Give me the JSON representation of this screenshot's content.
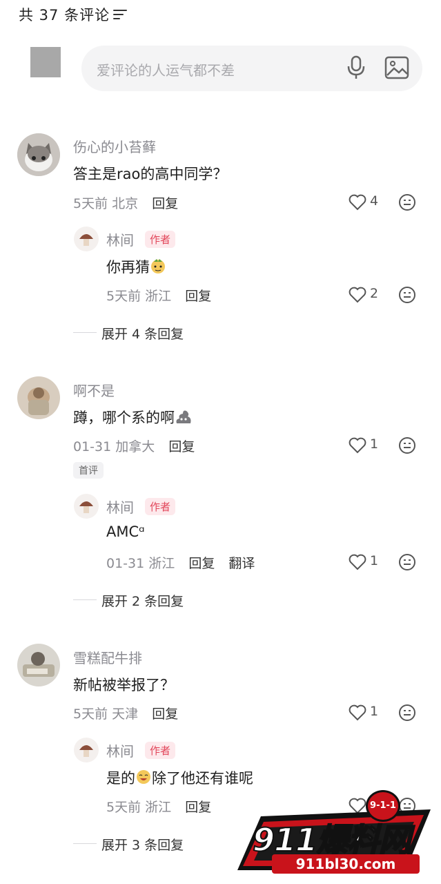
{
  "header": {
    "title": "共 37 条评论"
  },
  "composer": {
    "placeholder": "爱评论的人运气都不差"
  },
  "comments": [
    {
      "user": "伤心的小苔藓",
      "text": "答主是rao的高中同学？",
      "time": "5天前",
      "location": "北京",
      "reply_label": "回复",
      "likes": "4",
      "reply": {
        "user": "林间",
        "badge": "作者",
        "text": "你再猜",
        "time": "5天前",
        "location": "浙江",
        "reply_label": "回复",
        "likes": "2"
      },
      "expand": "展开 4 条回复"
    },
    {
      "user": "啊不是",
      "text": "蹲，哪个系的啊",
      "time": "01-31",
      "location": "加拿大",
      "reply_label": "回复",
      "likes": "1",
      "tag": "首评",
      "reply": {
        "user": "林间",
        "badge": "作者",
        "text": "AMCᵅ",
        "time": "01-31",
        "location": "浙江",
        "reply_label": "回复",
        "translate_label": "翻译",
        "likes": "1"
      },
      "expand": "展开 2 条回复"
    },
    {
      "user": "雪糕配牛排",
      "text": "新帖被举报了？",
      "time": "5天前",
      "location": "天津",
      "reply_label": "回复",
      "likes": "1",
      "reply": {
        "user": "林间",
        "badge": "作者",
        "text_before": "是的",
        "text_after": "除了他还有谁呢",
        "time": "5天前",
        "location": "浙江",
        "reply_label": "回复"
      },
      "expand": "展开 3 条回复"
    }
  ],
  "watermark": {
    "brand": "911爆料网",
    "url": "911bl30.com",
    "badge": "9-1-1"
  }
}
